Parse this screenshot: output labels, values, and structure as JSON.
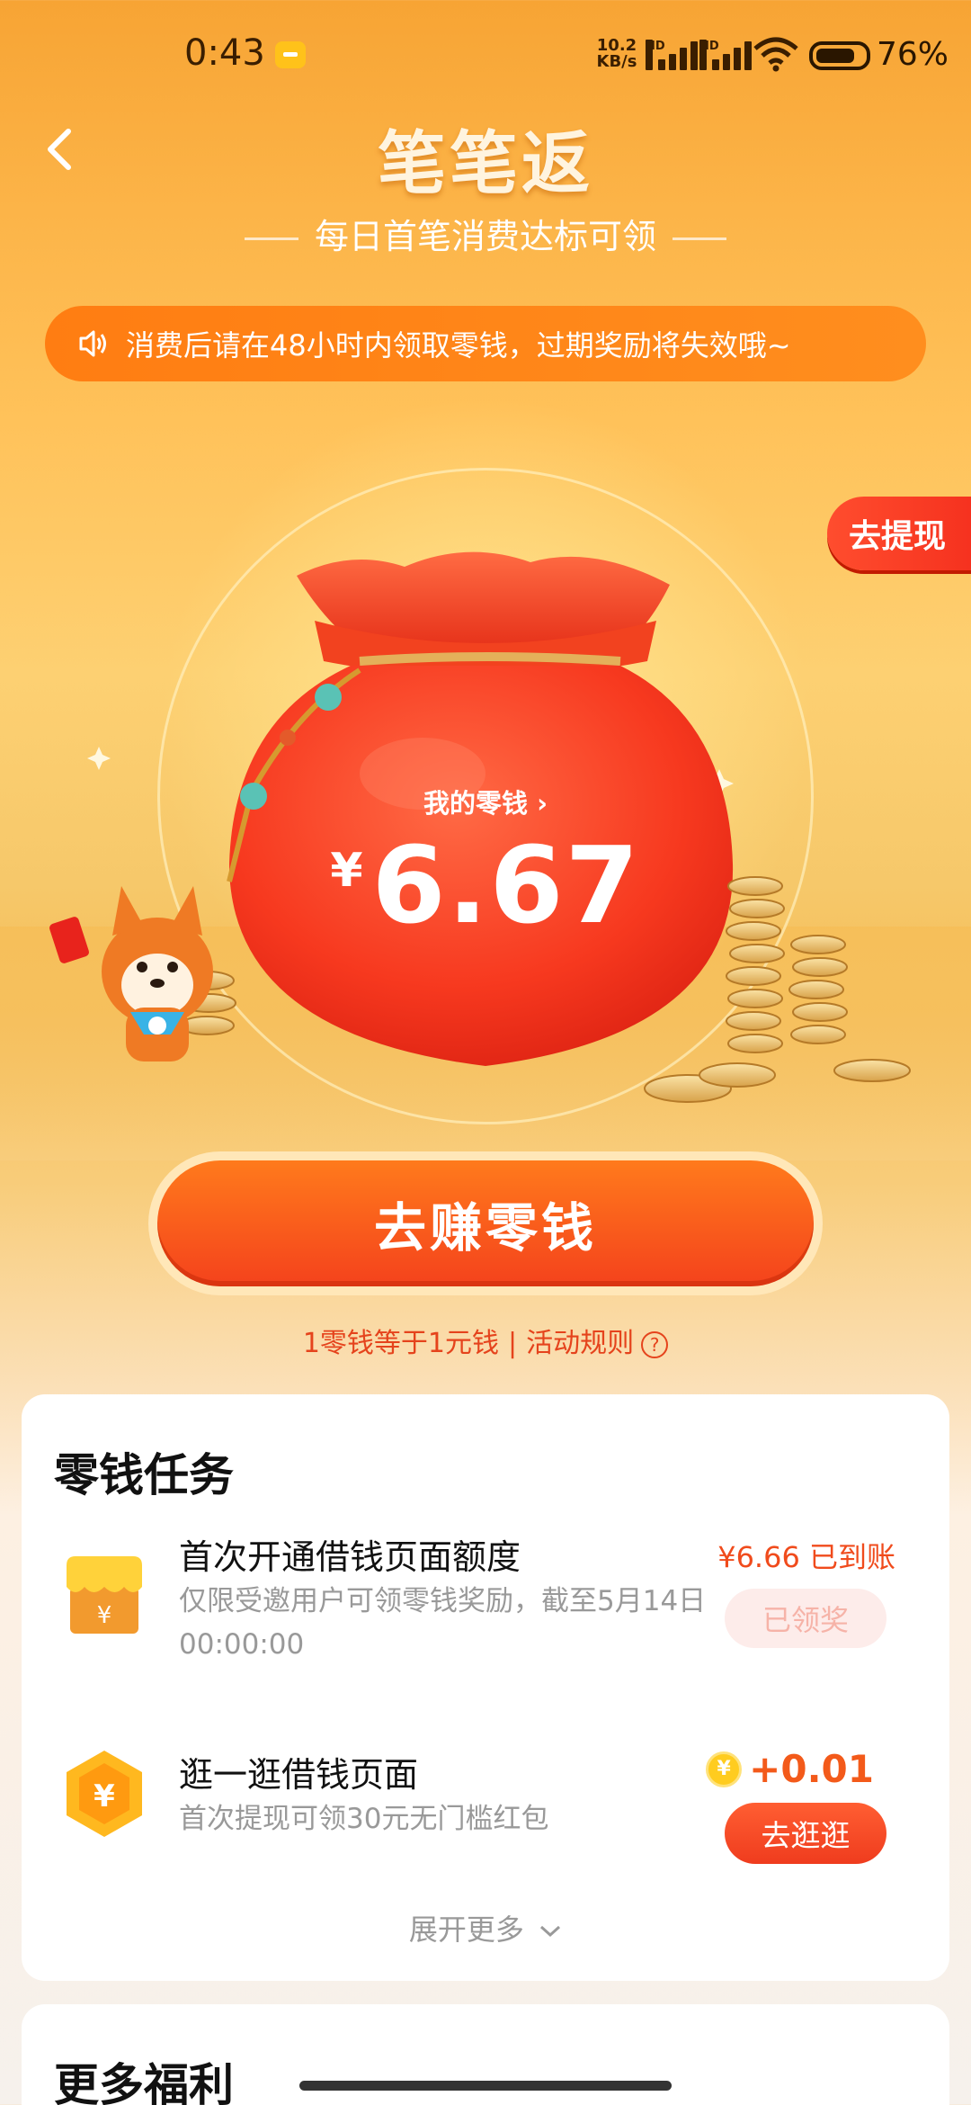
{
  "status_bar": {
    "time": "0:43",
    "net_speed_value": "10.2",
    "net_speed_unit": "KB/s",
    "hd_label": "HD",
    "battery": "76%"
  },
  "header": {
    "title": "笔笔返",
    "subtitle": "每日首笔消费达标可领"
  },
  "notice": {
    "text": "消费后请在48小时内领取零钱，过期奖励将失效哦~"
  },
  "withdraw_tab": {
    "label": "去提现"
  },
  "wallet": {
    "label": "我的零钱",
    "chevron": "›",
    "currency": "¥",
    "amount": "6.67"
  },
  "cta": {
    "label": "去赚零钱"
  },
  "rules": {
    "exchange_text": "1零钱等于1元钱",
    "separator": "|",
    "rules_link": "活动规则",
    "help": "?"
  },
  "task_card": {
    "title": "零钱任务",
    "tasks": [
      {
        "title": "首次开通借钱页面额度",
        "desc": "仅限受邀用户可领零钱奖励，截至5月14日00:00:00",
        "reward_text": "¥6.66 已到账",
        "button": "已领奖",
        "icon": "shop-icon",
        "icon_symbol": "¥"
      },
      {
        "title": "逛一逛借钱页面",
        "desc": "首次提现可领30元无门槛红包",
        "reward_coin": "¥",
        "reward_text": "+0.01",
        "button": "去逛逛",
        "icon": "yen-hexagon-icon",
        "icon_symbol": "¥"
      }
    ],
    "expand": "展开更多"
  },
  "next_card": {
    "title_partial": "更多福利"
  },
  "colors": {
    "accent": "#f04b1c",
    "notice_bg": "#ff8618",
    "cta_top": "#ff7a1c",
    "cta_bottom": "#f4421c"
  }
}
